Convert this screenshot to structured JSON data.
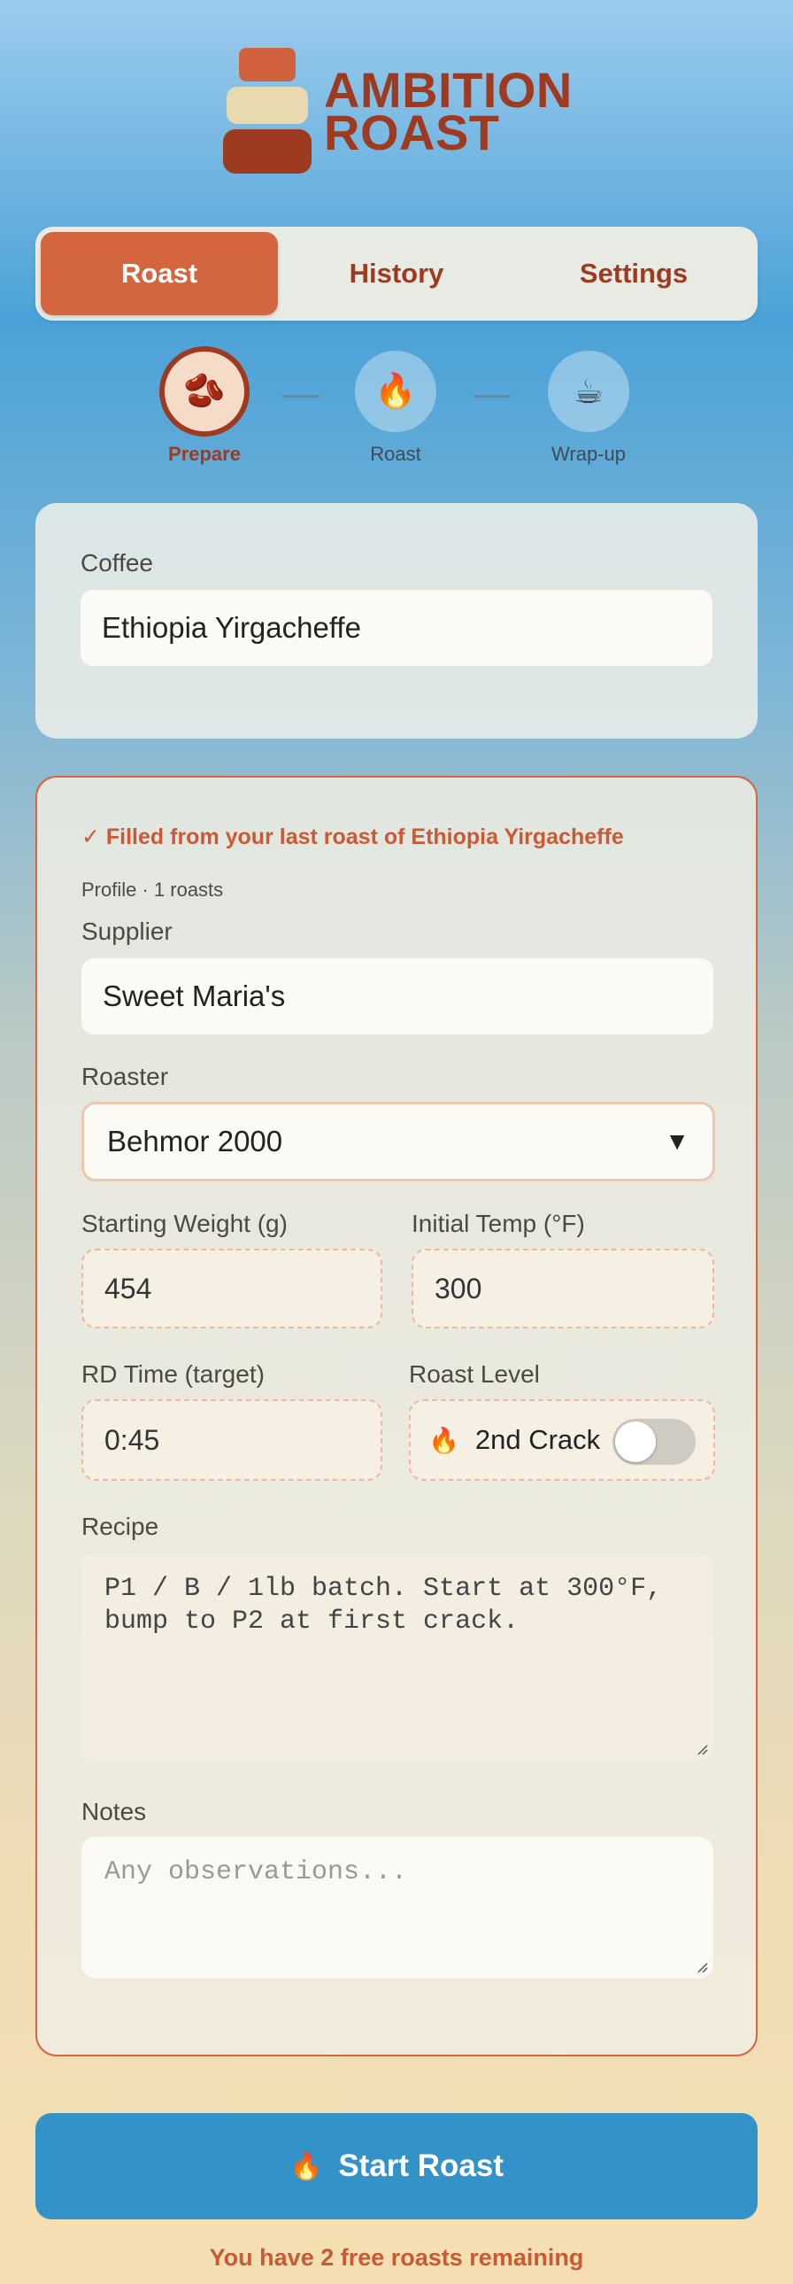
{
  "brand": {
    "line1": "AMBITION",
    "line2": "ROAST"
  },
  "tabs": [
    {
      "label": "Roast",
      "active": true
    },
    {
      "label": "History",
      "active": false
    },
    {
      "label": "Settings",
      "active": false
    }
  ],
  "stepper": {
    "steps": [
      {
        "label": "Prepare",
        "icon": "🫘",
        "icon_name": "coffee-bean-icon",
        "active": true
      },
      {
        "label": "Roast",
        "icon": "🔥",
        "icon_name": "fire-icon",
        "active": false
      },
      {
        "label": "Wrap-up",
        "icon": "☕",
        "icon_name": "coffee-cup-icon",
        "active": false
      }
    ]
  },
  "coffee": {
    "label": "Coffee",
    "value": "Ethiopia Yirgacheffe"
  },
  "details": {
    "filled_note": "✓ Filled from your last roast of Ethiopia Yirgacheffe",
    "profile_note": "Profile · 1 roasts",
    "supplier": {
      "label": "Supplier",
      "value": "Sweet Maria's"
    },
    "roaster": {
      "label": "Roaster",
      "value": "Behmor 2000",
      "caret": "▼"
    },
    "starting_weight": {
      "label": "Starting Weight (g)",
      "value": "454"
    },
    "initial_temp": {
      "label": "Initial Temp (°F)",
      "value": "300"
    },
    "rd_time": {
      "label": "RD Time (target)",
      "value": "0:45"
    },
    "roast_level": {
      "label": "Roast Level",
      "icon": "🔥",
      "value": "2nd Crack",
      "toggle_on": false
    },
    "recipe": {
      "label": "Recipe",
      "value": "P1 / B / 1lb batch. Start at 300°F, bump to P2 at first crack."
    },
    "notes": {
      "label": "Notes",
      "placeholder": "Any observations..."
    }
  },
  "start_button": {
    "icon": "🔥",
    "label": "Start Roast"
  },
  "free_note": "You have 2 free roasts remaining",
  "colors": {
    "accent": "#d3653f",
    "brand": "#9e3a1f",
    "primary_button": "#3393c8"
  }
}
